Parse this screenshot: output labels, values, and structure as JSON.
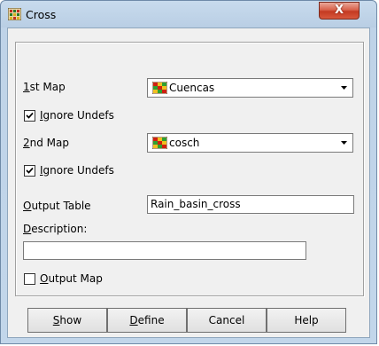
{
  "window": {
    "title": "Cross",
    "close_glyph": "X"
  },
  "form": {
    "map1": {
      "label_key": "1",
      "label_rest": "st Map",
      "value": "Cuencas",
      "ignore_label_key": "I",
      "ignore_label_rest": "gnore Undefs",
      "ignore_checked": true
    },
    "map2": {
      "label_key": "2",
      "label_rest": "nd Map",
      "value": "cosch",
      "ignore_label_key": "I",
      "ignore_label_rest": "gnore Undefs",
      "ignore_checked": true
    },
    "output_table": {
      "label_key": "O",
      "label_rest": "utput Table",
      "value": "Rain_basin_cross"
    },
    "description": {
      "label_key": "D",
      "label_rest": "escription:",
      "value": ""
    },
    "output_map": {
      "label_key": "O",
      "label_rest": "utput Map",
      "checked": false
    }
  },
  "buttons": {
    "show": {
      "key": "S",
      "rest": "how"
    },
    "define": {
      "key": "D",
      "rest": "efine"
    },
    "cancel": {
      "label": "Cancel"
    },
    "help": {
      "label": "Help"
    }
  },
  "icons": {
    "app": "cross-app-icon",
    "map": "raster-map-icon",
    "dropdown": "chevron-down-icon"
  }
}
